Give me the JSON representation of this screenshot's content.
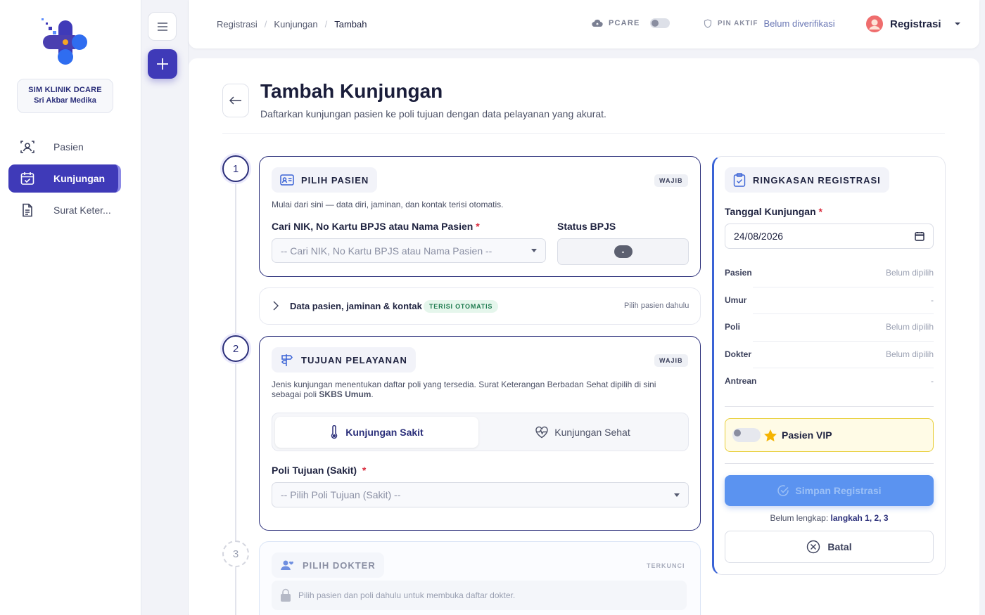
{
  "sidebar": {
    "clinic_name": "SIM KLINIK DCARE",
    "clinic_sub": "Sri Akbar Medika",
    "items": [
      {
        "label": "Pasien",
        "icon": "user-id-icon",
        "active": false
      },
      {
        "label": "Kunjungan",
        "icon": "calendar-check-icon",
        "active": true
      },
      {
        "label": "Surat Keter...",
        "icon": "document-icon",
        "active": false
      }
    ]
  },
  "header": {
    "breadcrumb": [
      "Registrasi",
      "Kunjungan",
      "Tambah"
    ],
    "pcare_label": "PCARE",
    "pin_label": "PIN AKTIF",
    "pin_status": "Belum diverifikasi",
    "user_name": "Registrasi"
  },
  "page": {
    "title": "Tambah Kunjungan",
    "subtitle": "Daftarkan kunjungan pasien ke poli tujuan dengan data pelayanan yang akurat."
  },
  "steps": [
    "1",
    "2",
    "3"
  ],
  "step1": {
    "header": "PILIH PASIEN",
    "badge": "WAJIB",
    "desc": "Mulai dari sini — data diri, jaminan, dan kontak terisi otomatis.",
    "search_label": "Cari NIK, No Kartu BPJS atau Nama Pasien",
    "search_placeholder": "-- Cari NIK, No Kartu BPJS atau Nama Pasien --",
    "bpjs_label": "Status BPJS",
    "bpjs_value": "-"
  },
  "collapse": {
    "label": "Data pasien, jaminan & kontak",
    "badge": "TERISI OTOMATIS",
    "hint": "Pilih pasien dahulu"
  },
  "step2": {
    "header": "TUJUAN PELAYANAN",
    "badge": "WAJIB",
    "desc_a": "Jenis kunjungan menentukan daftar poli yang tersedia. Surat Keterangan Berbadan Sehat dipilih di sini",
    "desc_b": "sebagai poli",
    "desc_bold": "SKBS Umum",
    "desc_end": ".",
    "tab_sick": "Kunjungan Sakit",
    "tab_healthy": "Kunjungan Sehat",
    "poli_label": "Poli Tujuan (Sakit)",
    "poli_placeholder": "-- Pilih Poli Tujuan (Sakit) --"
  },
  "step3": {
    "header": "PILIH DOKTER",
    "badge": "TERKUNCI",
    "locked_msg": "Pilih pasien dan poli dahulu untuk membuka daftar dokter."
  },
  "summary": {
    "header": "RINGKASAN REGISTRASI",
    "date_label": "Tanggal Kunjungan",
    "date_value": "24/08/2026",
    "rows": [
      {
        "k": "Pasien",
        "v": "Belum dipilih"
      },
      {
        "k": "Umur",
        "v": "-"
      },
      {
        "k": "Poli",
        "v": "Belum dipilih"
      },
      {
        "k": "Dokter",
        "v": "Belum dipilih"
      },
      {
        "k": "Antrean",
        "v": "-"
      }
    ],
    "vip_label": "Pasien VIP",
    "save_label": "Simpan Registrasi",
    "incomplete_prefix": "Belum lengkap:",
    "incomplete_steps": "langkah 1, 2, 3",
    "cancel_label": "Batal"
  },
  "colors": {
    "primary": "#3f3ab8",
    "accent_blue": "#3a63d6",
    "vip_bg": "#fffbe6",
    "vip_border": "#e8cf3a"
  }
}
